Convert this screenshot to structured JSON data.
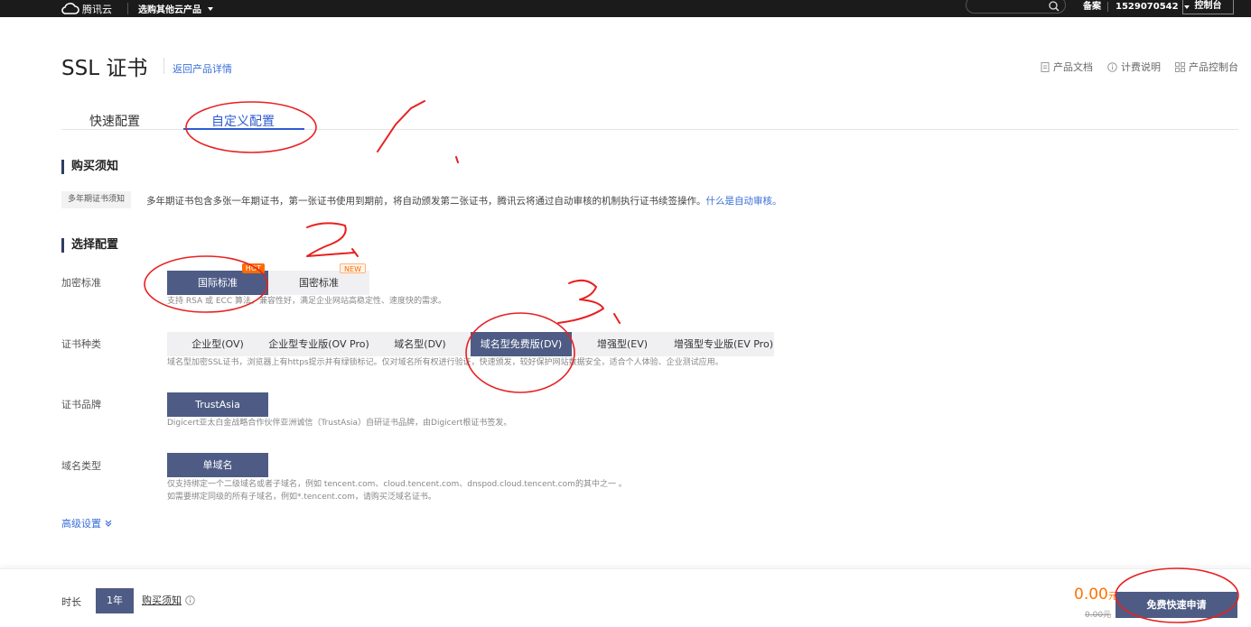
{
  "topbar": {
    "logo": "腾讯云",
    "product_menu": "选购其他云产品",
    "beian": "备案",
    "account": "1529070542",
    "console": "控制台"
  },
  "header": {
    "title": "SSL 证书",
    "back": "返回产品详情",
    "links": [
      "产品文档",
      "计费说明",
      "产品控制台"
    ]
  },
  "tabs": [
    "快速配置",
    "自定义配置"
  ],
  "purchase": {
    "heading": "购买须知",
    "tag": "多年期证书须知",
    "text": "多年期证书包含多张一年期证书，第一张证书使用到期前，将自动颁发第二张证书，腾讯云将通过自动审核的机制执行证书续签操作。",
    "link": "什么是自动审核。"
  },
  "config": {
    "heading": "选择配置",
    "encryption": {
      "label": "加密标准",
      "options": [
        "国际标准",
        "国密标准"
      ],
      "badges": [
        "HOT",
        "NEW"
      ],
      "hint": "支持 RSA 或 ECC 算法，兼容性好，满足企业网站高稳定性、速度快的需求。"
    },
    "cert_type": {
      "label": "证书种类",
      "options": [
        "企业型(OV)",
        "企业型专业版(OV Pro)",
        "域名型(DV)",
        "域名型免费版(DV)",
        "增强型(EV)",
        "增强型专业版(EV Pro)"
      ],
      "hint": "域名型加密SSL证书，浏览器上有https提示并有绿锁标记。仅对域名所有权进行验证，快速颁发，较好保护网站数据安全，适合个人体验、企业测试应用。"
    },
    "brand": {
      "label": "证书品牌",
      "option": "TrustAsia",
      "hint": "Digicert亚太白金战略合作伙伴亚洲诚信（TrustAsia）自研证书品牌，由Digicert根证书签发。"
    },
    "domain": {
      "label": "域名类型",
      "option": "单域名",
      "hint1": "仅支持绑定一个二级域名或者子域名，例如 tencent.com、cloud.tencent.com、dnspod.cloud.tencent.com的其中之一 。",
      "hint2": "如需要绑定同级的所有子域名，例如*.tencent.com，请购买泛域名证书。"
    },
    "advanced": "高级设置"
  },
  "bottom": {
    "duration_label": "时长",
    "duration": "1年",
    "notice": "购买须知",
    "price": "0.00",
    "currency": "元",
    "orig_price": "0.00元",
    "apply": "免费快速申请"
  },
  "annotations": [
    "1",
    "2",
    "3"
  ],
  "colors": {
    "selected": "#4e5c85",
    "link": "#3a6fd8",
    "tab_active": "#2d5bd2",
    "price": "#ff7200",
    "hot": "#ff6a00",
    "annotation": "#e82020"
  }
}
